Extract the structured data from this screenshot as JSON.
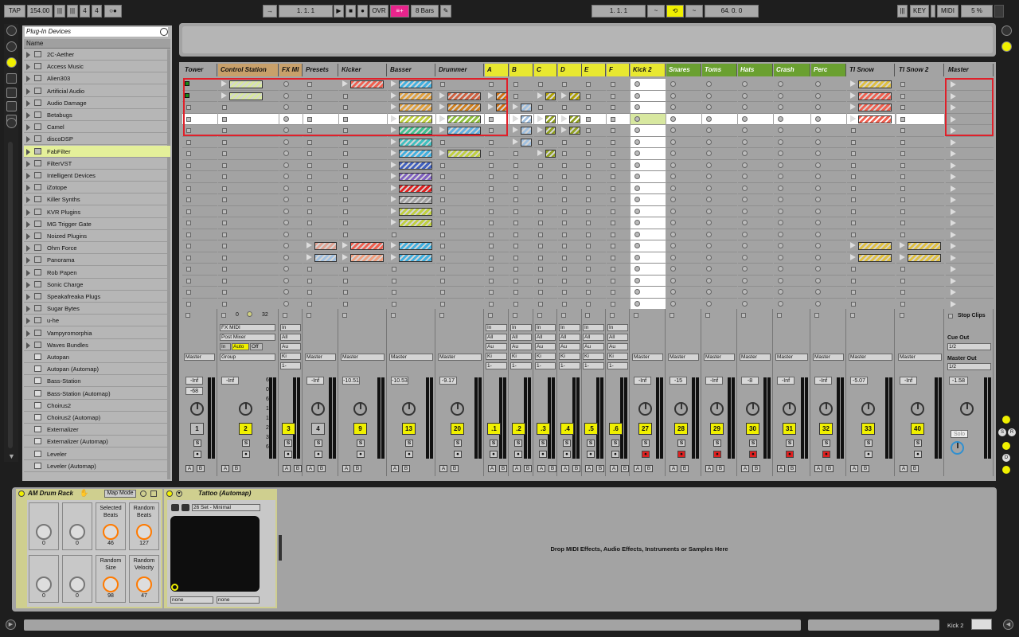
{
  "transport": {
    "tap": "TAP",
    "tempo": "154.00",
    "sig_num": "4",
    "sig_den": "4",
    "position": "1.   1.   1",
    "ovr": "OVR",
    "bars": "8 Bars",
    "loop_start": "1.   1.   1",
    "loop_len": "64.   0.   0",
    "key": "KEY",
    "midi": "MIDI",
    "cpu": "5 %"
  },
  "browser": {
    "title": "Plug-In Devices",
    "col_name": "Name",
    "folders": [
      "2C-Aether",
      "Access Music",
      "Alien303",
      "Artificial Audio",
      "Audio Damage",
      "Betabugs",
      "Camel",
      "discoDSP",
      "FabFilter",
      "FilterVST",
      "Intelligent Devices",
      "iZotope",
      "Killer Synths",
      "KVR Plugins",
      "MG Trigger Gate",
      "Noized Plugins",
      "Ohm Force",
      "Panorama",
      "Rob Papen",
      "Sonic Charge",
      "Speakafreaka Plugs",
      "Sugar Bytes",
      "u-he",
      "Vampyromorphia",
      "Waves Bundles"
    ],
    "plugins": [
      "Autopan",
      "Autopan (Automap)",
      "Bass-Station",
      "Bass-Station (Automap)",
      "Choirus2",
      "Choirus2 (Automap)",
      "Externalizer",
      "Externalizer (Automap)",
      "Leveler",
      "Leveler (Automap)"
    ],
    "selected": "FabFilter"
  },
  "tracks": [
    {
      "name": "Tower",
      "color": "#a3a3a3"
    },
    {
      "name": "Control Station",
      "color": "#c8a06a"
    },
    {
      "name": "FX MI",
      "color": "#c8a06a"
    },
    {
      "name": "Presets",
      "color": "#a3a3a3"
    },
    {
      "name": "Kicker",
      "color": "#a3a3a3"
    },
    {
      "name": "Basser",
      "color": "#a3a3a3"
    },
    {
      "name": "Drummer",
      "color": "#a3a3a3"
    },
    {
      "name": "A",
      "color": "#e8e830"
    },
    {
      "name": "B",
      "color": "#e8e830"
    },
    {
      "name": "C",
      "color": "#e8e830"
    },
    {
      "name": "D",
      "color": "#e8e830"
    },
    {
      "name": "E",
      "color": "#e8e830"
    },
    {
      "name": "F",
      "color": "#e8e830"
    },
    {
      "name": "Kick 2",
      "color": "#e8e830"
    },
    {
      "name": "Snares",
      "color": "#6aa030"
    },
    {
      "name": "Toms",
      "color": "#6aa030"
    },
    {
      "name": "Hats",
      "color": "#6aa030"
    },
    {
      "name": "Crash",
      "color": "#6aa030"
    },
    {
      "name": "Perc",
      "color": "#6aa030"
    },
    {
      "name": "TI Snow",
      "color": "#a3a3a3"
    },
    {
      "name": "TI Snow 2",
      "color": "#a3a3a3"
    },
    {
      "name": "Master",
      "color": "#a3a3a3"
    }
  ],
  "mixer": {
    "stop_clips": "Stop Clips",
    "cue_out": "Cue Out",
    "cue_val": "1/2",
    "master_out": "Master Out",
    "master_val": "1/2",
    "ctrl_station": {
      "val1": "0",
      "val2": "32",
      "fxmidi": "FX MIDI",
      "post": "Post Mixer",
      "in": "In",
      "auto": "Auto",
      "off": "Off",
      "group": "Group"
    },
    "volumes": [
      "-Inf",
      "-Inf",
      "-Inf",
      "-10.51",
      "-10.53",
      "-9.17",
      "-Inf",
      "-15",
      "-Inf",
      "-8",
      "-Inf",
      "-Inf",
      "-5.07",
      "-Inf",
      "-1.58"
    ],
    "vol_first": "-68",
    "track_numbers": [
      "1",
      "2",
      "3",
      "4",
      "9",
      "13",
      "20",
      ".1",
      ".2",
      ".3",
      ".4",
      ".5",
      ".6",
      "27",
      "28",
      "29",
      "30",
      "31",
      "32",
      "33",
      "40"
    ],
    "scale": [
      "6",
      "0",
      "6",
      "12",
      "18",
      "24",
      "36",
      "60"
    ],
    "output": "Master",
    "solo": "Solo"
  },
  "device": {
    "rack_name": "AM Drum Rack",
    "map_mode": "Map Mode",
    "pads": [
      {
        "label": "",
        "value": "0"
      },
      {
        "label": "",
        "value": "0"
      },
      {
        "label": "Selected Beats",
        "value": "46"
      },
      {
        "label": "Random Beats",
        "value": "127"
      },
      {
        "label": "",
        "value": "0"
      },
      {
        "label": "",
        "value": "0"
      },
      {
        "label": "Random Size",
        "value": "98"
      },
      {
        "label": "Random Velocity",
        "value": "47"
      }
    ],
    "plugin_name": "Tattoo (Automap)",
    "preset": "26 Set - Minimal",
    "none1": "none",
    "none2": "none",
    "drop_hint": "Drop MIDI Effects, Audio Effects, Instruments or Samples Here"
  },
  "status": {
    "track": "Kick 2"
  }
}
